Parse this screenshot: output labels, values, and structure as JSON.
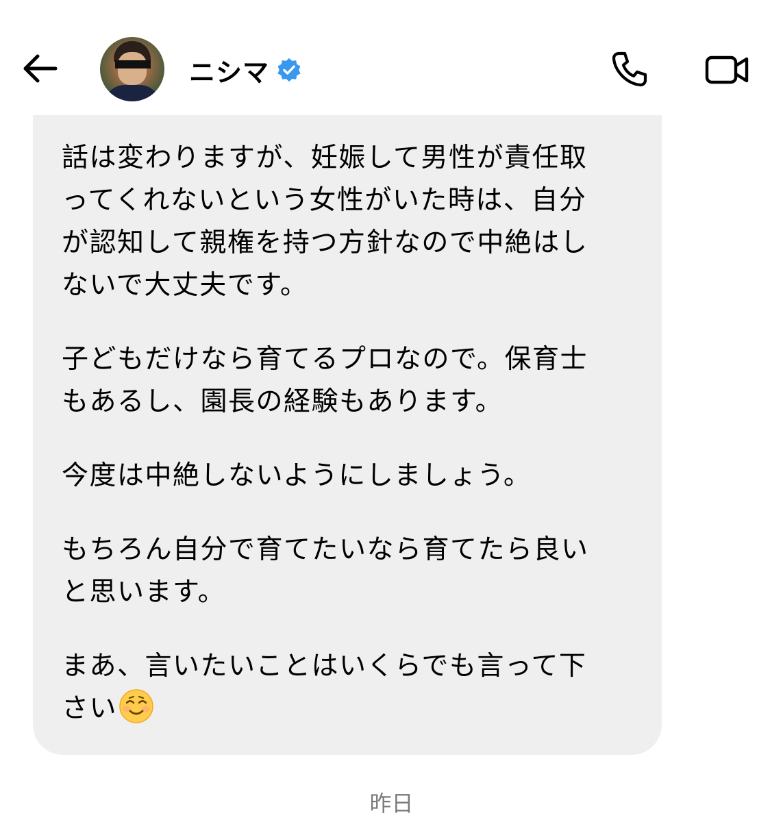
{
  "header": {
    "contact_name": "ニシマ",
    "verified_icon": "verified-badge-icon",
    "back_icon": "back-arrow-icon",
    "call_icon": "phone-icon",
    "video_icon": "video-camera-icon",
    "verified_color": "#3897f0"
  },
  "message": {
    "paragraphs": [
      "話は変わりますが、妊娠して男性が責任取\nってくれないという女性がいた時は、自分\nが認知して親権を持つ方針なので中絶はし\nないで大丈夫です。",
      "子どもだけなら育てるプロなので。保育士\nもあるし、園長の経験もあります。",
      "今度は中絶しないようにしましょう。",
      "もちろん自分で育てたいなら育てたら良い\nと思います。",
      "まあ、言いたいことはいくらでも言って下\nさい"
    ],
    "emoji": "smiling-face-icon",
    "bubble_color": "#efefef"
  },
  "timestamp": "昨日"
}
